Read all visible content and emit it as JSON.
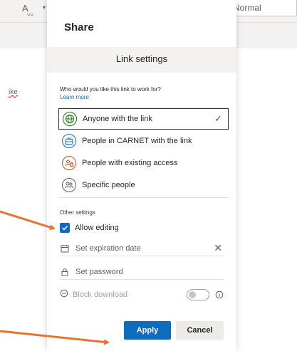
{
  "background": {
    "style_label": "Normal",
    "doc_text": "ike",
    "font_color_glyph": "A"
  },
  "share_panel": {
    "title": "Share",
    "link_settings_header": "Link settings",
    "question": "Who would you like this link to work for?",
    "learn_more": "Learn more",
    "options": [
      {
        "label": "Anyone with the link",
        "icon": "globe-icon",
        "selected": true,
        "color": "#107c10"
      },
      {
        "label": "People in CARNET with the link",
        "icon": "briefcase-icon",
        "selected": false,
        "color": "#0f6cbd"
      },
      {
        "label": "People with existing access",
        "icon": "people-lock-icon",
        "selected": false,
        "color": "#ca5010"
      },
      {
        "label": "Specific people",
        "icon": "people-icon",
        "selected": false,
        "color": "#605e5c"
      }
    ],
    "other_settings": {
      "header": "Other settings",
      "allow_editing": {
        "label": "Allow editing",
        "checked": true
      },
      "expiration_placeholder": "Set expiration date",
      "password_placeholder": "Set password",
      "block_download": {
        "label": "Block download",
        "enabled": false
      }
    },
    "buttons": {
      "apply": "Apply",
      "cancel": "Cancel"
    }
  },
  "colors": {
    "accent": "#0f6cbd",
    "arrow": "#e97132"
  }
}
